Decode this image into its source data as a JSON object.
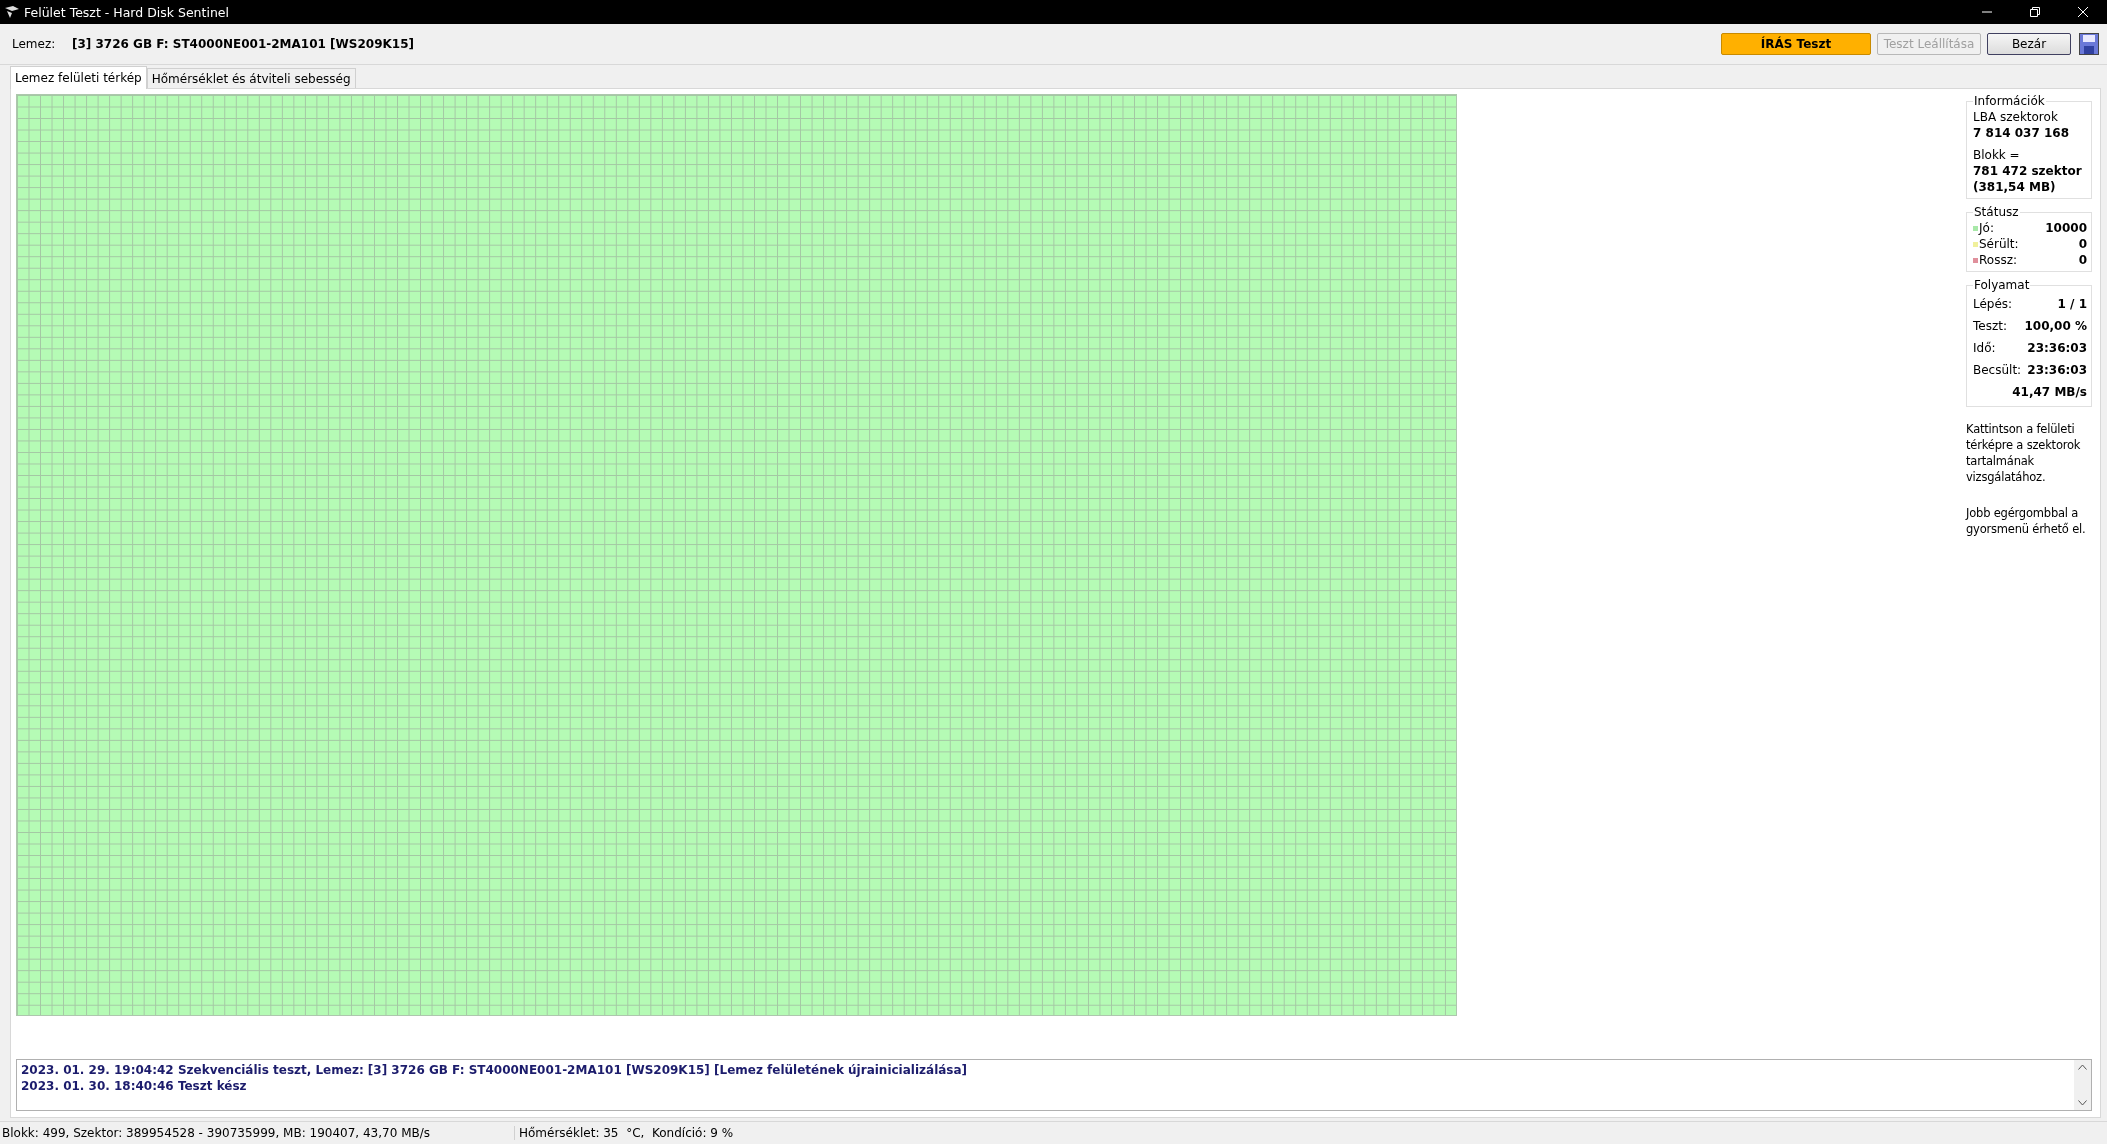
{
  "window": {
    "title": "Felület Teszt - Hard Disk Sentinel"
  },
  "toolbar": {
    "disk_label": "Lemez:",
    "disk_value": "[3] 3726 GB F: ST4000NE001-2MA101 [WS209K15]",
    "buttons": [
      {
        "kind": "primary",
        "label": "ÍRÁS Teszt",
        "disabled": false
      },
      {
        "kind": "normal",
        "label": "Teszt Leállítása",
        "disabled": true
      },
      {
        "kind": "normal",
        "label": "Bezár",
        "disabled": false
      }
    ]
  },
  "tabs": [
    {
      "label": "Lemez felületi térkép",
      "selected": true
    },
    {
      "label": "Hőmérséklet és átviteli sebesség",
      "selected": false
    }
  ],
  "info": {
    "title": "Információk",
    "lba_label": "LBA szektorok",
    "lba_value": "7 814 037 168",
    "block_label": "Blokk =",
    "block_value": "781 472 szektor",
    "block_size": "(381,54 MB)"
  },
  "status": {
    "title": "Státusz",
    "items": [
      {
        "label": "Jó:",
        "value": "10000",
        "color": "#a8e8a8"
      },
      {
        "label": "Sérült:",
        "value": "0",
        "color": "#f0f09c"
      },
      {
        "label": "Rossz:",
        "value": "0",
        "color": "#e0909c"
      }
    ]
  },
  "progress": {
    "title": "Folyamat",
    "rows": [
      {
        "label": "Lépés:",
        "value": "1 / 1"
      },
      {
        "label": "Teszt:",
        "value": "100,00 %"
      },
      {
        "label": "Idő:",
        "value": "23:36:03"
      },
      {
        "label": "Becsült:",
        "value": "23:36:03"
      },
      {
        "value": "41,47 MB/s"
      }
    ]
  },
  "hints": [
    "Kattintson a felületi térképre a szektorok tartalmának vizsgálatához.",
    "Jobb egérgombbal a gyorsmenü érhető el."
  ],
  "log": [
    {
      "date": "2023. 01. 29.",
      "time": "19:04:42",
      "message": "Szekvenciális teszt, Lemez: [3] 3726 GB F: ST4000NE001-2MA101 [WS209K15] [Lemez felületének újrainicializálása]"
    },
    {
      "date": "2023. 01. 30.",
      "time": "18:40:46",
      "message": "Teszt kész"
    }
  ],
  "status_bar": [
    "Blokk: 499, Szektor: 389954528 - 390735999, MB: 190407, 43,70 MB/s",
    "Hőmérséklet: 35  °C,  Kondíció: 9 %"
  ]
}
